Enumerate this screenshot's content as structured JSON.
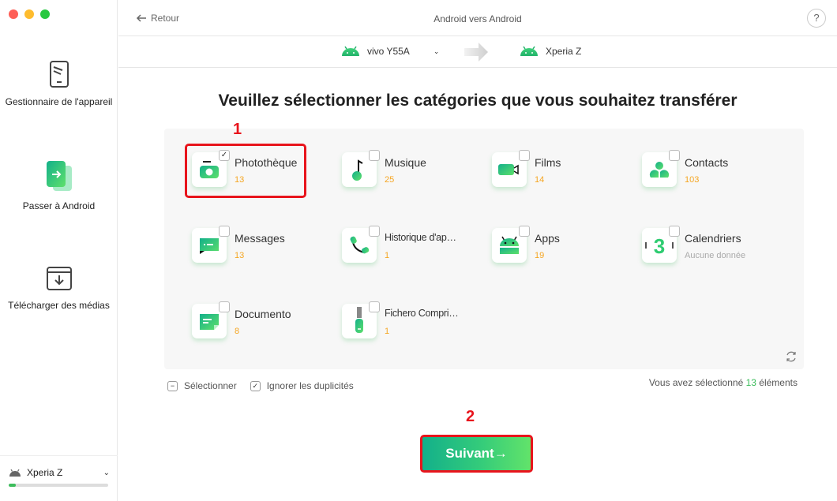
{
  "window": {
    "title": "Android vers Android",
    "back_label": "Retour",
    "help_label": "?"
  },
  "sidebar": {
    "items": [
      {
        "label": "Gestionnaire de l'appareil",
        "icon": "phone-icon"
      },
      {
        "label": "Passer à Android",
        "icon": "transfer-icon",
        "active": true
      },
      {
        "label": "Télécharger des médias",
        "icon": "download-media-icon"
      }
    ],
    "device": {
      "name": "Xperia Z",
      "storage_used_fraction": 0.07
    }
  },
  "devices": {
    "source": "vivo Y55A",
    "target": "Xperia Z"
  },
  "main": {
    "heading": "Veuillez sélectionner les catégories que vous souhaitez transférer",
    "categories": [
      {
        "label": "Photothèque",
        "count": "13",
        "checked": true,
        "icon": "photo-library-icon"
      },
      {
        "label": "Musique",
        "count": "25",
        "checked": false,
        "icon": "music-note-icon"
      },
      {
        "label": "Films",
        "count": "14",
        "checked": false,
        "icon": "video-camera-icon"
      },
      {
        "label": "Contacts",
        "count": "103",
        "checked": false,
        "icon": "contacts-icon"
      },
      {
        "label": "Messages",
        "count": "13",
        "checked": false,
        "icon": "message-icon"
      },
      {
        "label": "Historique d'ap…",
        "count": "1",
        "checked": false,
        "icon": "call-history-icon"
      },
      {
        "label": "Apps",
        "count": "19",
        "checked": false,
        "icon": "android-apps-icon"
      },
      {
        "label": "Calendriers",
        "count": "Aucune donnée",
        "checked": false,
        "icon": "calendar-icon"
      },
      {
        "label": "Documento",
        "count": "8",
        "checked": false,
        "icon": "document-icon"
      },
      {
        "label": "Fichero Compri…",
        "count": "1",
        "checked": false,
        "icon": "zip-file-icon"
      }
    ],
    "options": {
      "select_label": "Sélectionner",
      "ignore_duplicates_label": "Ignorer les duplicités",
      "ignore_duplicates_checked": true
    },
    "selection_status": {
      "prefix": "Vous avez sélectionné",
      "count": "13",
      "suffix": "éléments"
    },
    "next_label": "Suivant→"
  },
  "annotations": {
    "step1": "1",
    "step2": "2",
    "highlight_color": "#e8141c"
  },
  "colors": {
    "accent_green": "#3dbd5c",
    "count_orange": "#f5a623"
  }
}
